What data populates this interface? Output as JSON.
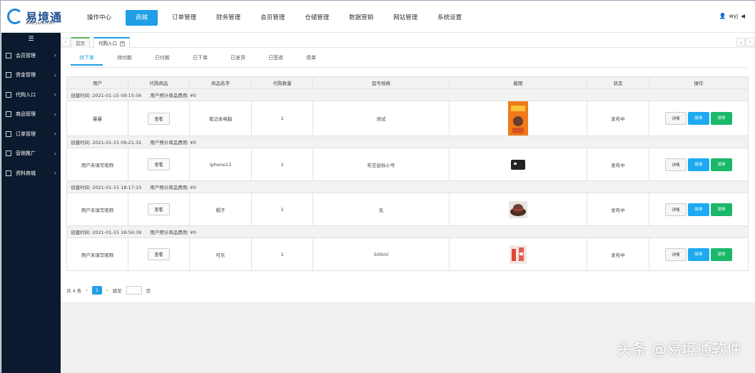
{
  "brand": {
    "name": "易境通",
    "url": "www.yejoin.com"
  },
  "nav": [
    {
      "label": "操作中心",
      "active": false
    },
    {
      "label": "商城",
      "active": true
    },
    {
      "label": "订单管理",
      "active": false
    },
    {
      "label": "财务管理",
      "active": false
    },
    {
      "label": "会员管理",
      "active": false
    },
    {
      "label": "仓储管理",
      "active": false
    },
    {
      "label": "数据营销",
      "active": false
    },
    {
      "label": "网站管理",
      "active": false
    },
    {
      "label": "系统设置",
      "active": false
    }
  ],
  "user": {
    "name": "wyj",
    "icon": "user-icon"
  },
  "sidebar": {
    "toggle_icon": "menu-icon",
    "items": [
      {
        "label": "会员管理"
      },
      {
        "label": "资金管理"
      },
      {
        "label": "代购入口"
      },
      {
        "label": "商品管理"
      },
      {
        "label": "订单管理"
      },
      {
        "label": "营销推广"
      },
      {
        "label": "资料商城"
      }
    ]
  },
  "page_tabs": {
    "home": "首页",
    "current": "代购入口"
  },
  "sub_tabs": [
    "待下单",
    "待付款",
    "已付款",
    "已下单",
    "已发货",
    "已签收",
    "退单"
  ],
  "table": {
    "headers": [
      "用户",
      "代购商品",
      "商品名字",
      "代购数量",
      "型号规格",
      "截图",
      "状态",
      "操作"
    ],
    "meta_cost_label": "用户预计商品费用: ¥0",
    "view_label": "查看",
    "ops": {
      "detail": "详情",
      "take": "接单",
      "pick": "退单"
    },
    "rows": [
      {
        "created": "创建时间: 2021-01-15 09:15:56",
        "user": "曼曼",
        "name": "笔记本电脑",
        "qty": "1",
        "spec": "测试",
        "status": "发布中",
        "thumb": "poster"
      },
      {
        "created": "创建时间: 2021-01-15 09:21:32",
        "user": "用户未填写昵称",
        "name": "iphone11",
        "qty": "1",
        "spec": "布艺鼠标小号",
        "status": "发布中",
        "thumb": "mousepad"
      },
      {
        "created": "创建时间: 2021-01-15 18:17:15",
        "user": "用户未填写昵称",
        "name": "帽子",
        "qty": "1",
        "spec": "无",
        "status": "发布中",
        "thumb": "hat"
      },
      {
        "created": "创建时间: 2021-01-15 18:56:39",
        "user": "用户未填写昵称",
        "name": "可乐",
        "qty": "1",
        "spec": "500ml",
        "status": "发布中",
        "thumb": "cola"
      }
    ]
  },
  "pager": {
    "total": "共 4 条",
    "page": "1",
    "goto": "跳至",
    "page_unit": "页"
  },
  "watermark": "头条 @易境通软件"
}
